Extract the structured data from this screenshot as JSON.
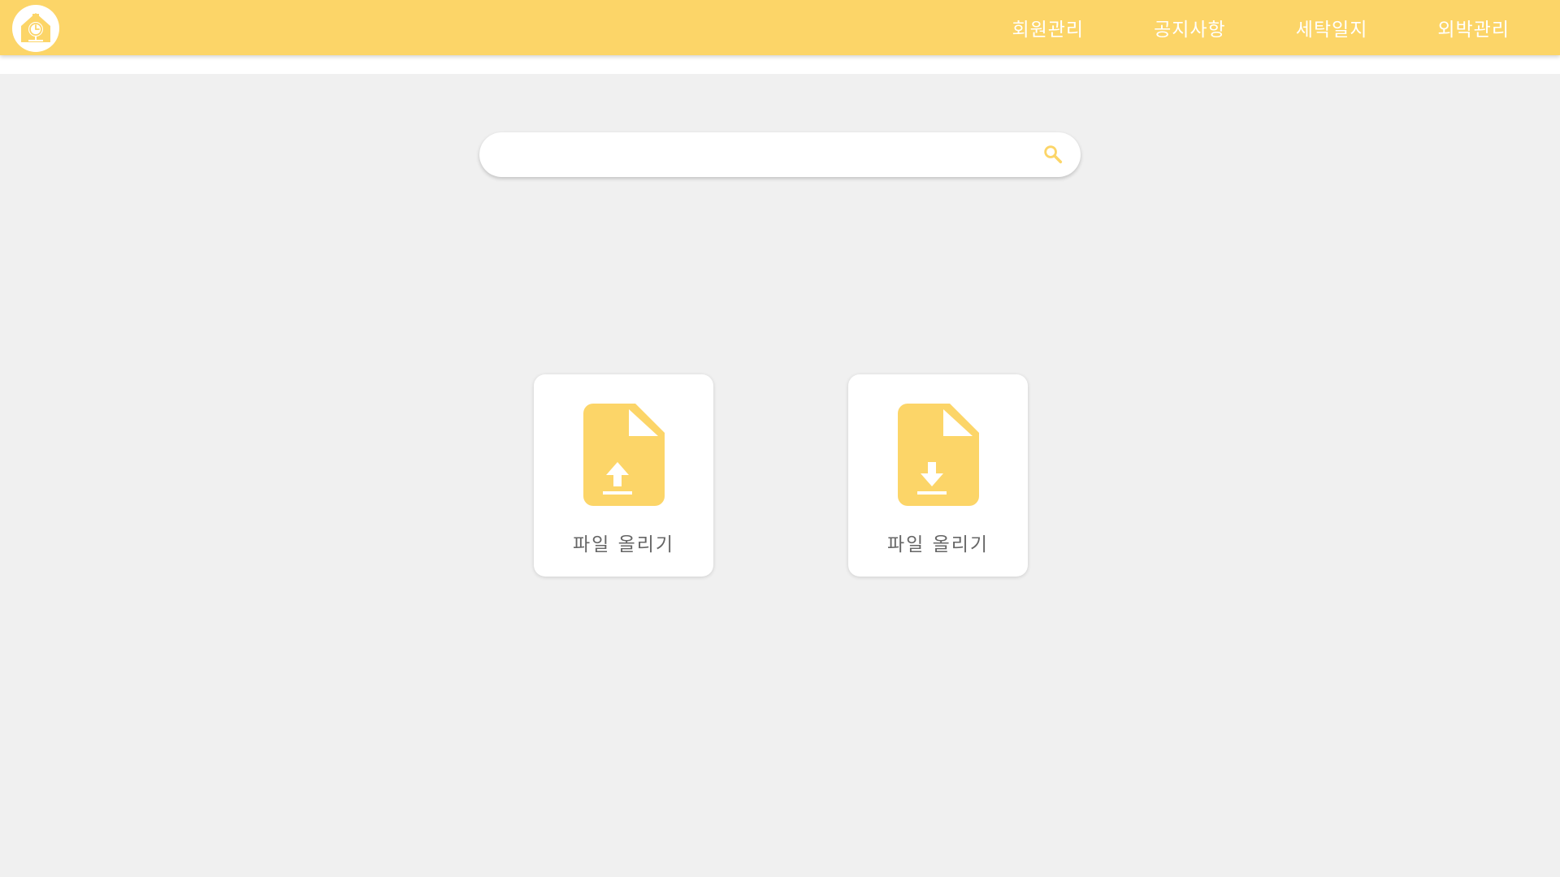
{
  "colors": {
    "accent": "#fcd568",
    "background": "#f0f0f0",
    "card": "#ffffff"
  },
  "logo": {
    "icon": "house-clock-icon"
  },
  "nav": {
    "items": [
      {
        "label": "회원관리"
      },
      {
        "label": "공지사항"
      },
      {
        "label": "세탁일지"
      },
      {
        "label": "외박관리"
      }
    ]
  },
  "search": {
    "value": "",
    "placeholder": "",
    "icon": "search-icon"
  },
  "cards": {
    "upload": {
      "label": "파일 올리기",
      "icon": "file-upload-icon"
    },
    "download": {
      "label": "파일 올리기",
      "icon": "file-download-icon"
    }
  }
}
